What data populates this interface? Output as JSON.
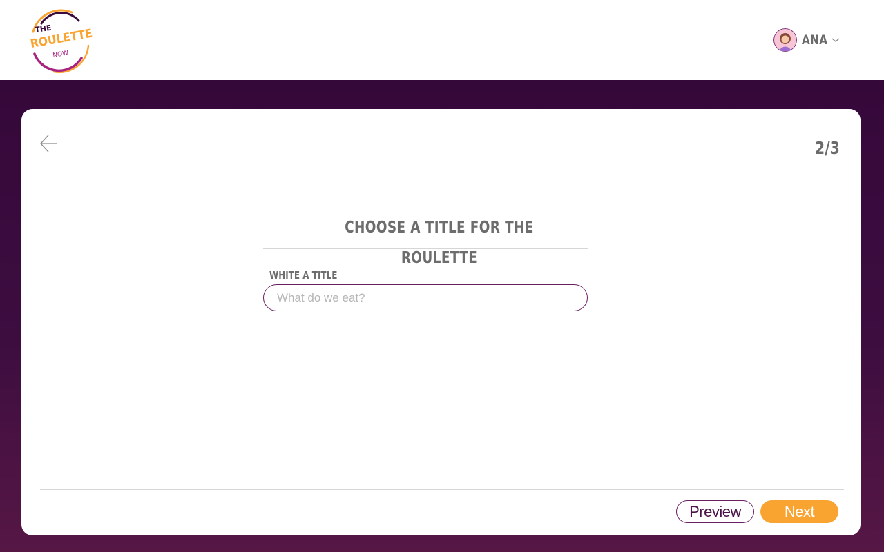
{
  "brand": {
    "logo_top": "THE",
    "logo_main": "ROULETTE",
    "logo_bottom": "NOW",
    "colors": {
      "purple_dark": "#35083a",
      "purple_accent": "#6b1f63",
      "orange": "#f9a430",
      "magenta": "#a8237f"
    }
  },
  "header": {
    "user": {
      "name": "ANA",
      "avatar_icon": "avatar-icon",
      "menu_icon": "chevron-down-icon"
    }
  },
  "wizard": {
    "step_indicator": "2/3",
    "back_icon": "arrow-left-icon",
    "section_title": "CHOOSE A TITLE FOR THE ROULETTE",
    "field_label": "WHITE A TITLE",
    "title_input": {
      "value": "",
      "placeholder": "What do we eat?"
    }
  },
  "footer": {
    "preview_label": "Preview",
    "next_label": "Next"
  }
}
